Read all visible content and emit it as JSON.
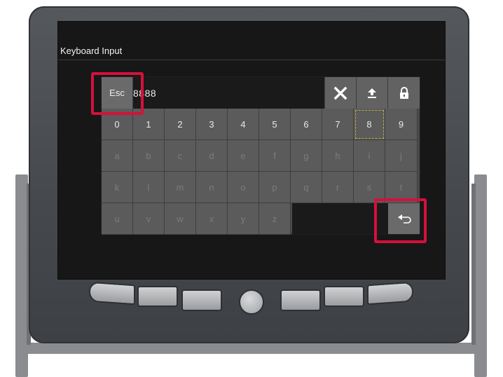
{
  "window": {
    "title": "Keyboard Input"
  },
  "input": {
    "value": "8888",
    "esc_label": "Esc"
  },
  "toolbar": {
    "clear_icon": "close-icon",
    "upload_icon": "upload-icon",
    "lock_icon": "lock-icon"
  },
  "keys": {
    "row1": [
      "0",
      "1",
      "2",
      "3",
      "4",
      "5",
      "6",
      "7",
      "8",
      "9"
    ],
    "row2": [
      "a",
      "b",
      "c",
      "d",
      "e",
      "f",
      "g",
      "h",
      "i",
      "j"
    ],
    "row3": [
      "k",
      "l",
      "m",
      "n",
      "o",
      "p",
      "q",
      "r",
      "s",
      "t"
    ],
    "row4": [
      "u",
      "v",
      "w",
      "x",
      "y",
      "z"
    ],
    "selected": "8"
  },
  "enter_icon": "enter-icon",
  "colors": {
    "highlight": "#d4103c",
    "screen_bg": "#171717",
    "key_bg": "#5b5b5b"
  }
}
